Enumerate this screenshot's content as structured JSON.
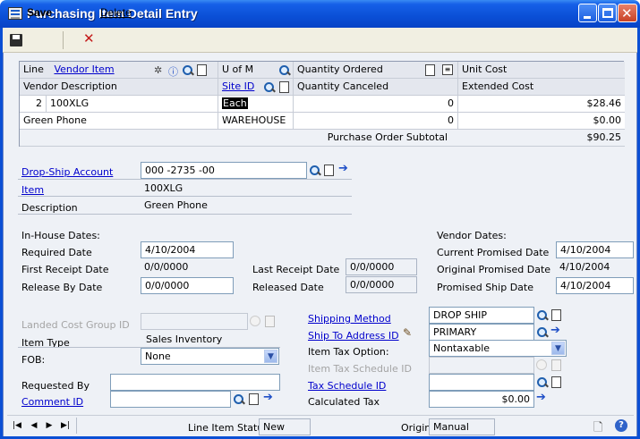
{
  "window": {
    "title": "Purchasing Item Detail Entry"
  },
  "toolbar": {
    "save_label": "Save",
    "delete_label": "Delete"
  },
  "grid": {
    "headers": {
      "line": "Line",
      "vendor_item": "Vendor Item",
      "u_of_m": "U of M",
      "quantity_ordered": "Quantity Ordered",
      "unit_cost": "Unit Cost",
      "vendor_description": "Vendor Description",
      "site_id": "Site ID",
      "quantity_canceled": "Quantity Canceled",
      "extended_cost": "Extended Cost"
    },
    "row": {
      "line": "2",
      "vendor_item": "100XLG",
      "u_of_m": "Each",
      "quantity_ordered": "0",
      "unit_cost": "$28.46",
      "vendor_description": "Green Phone",
      "site_id": "WAREHOUSE",
      "quantity_canceled": "0",
      "extended_cost": "$0.00"
    },
    "subtotal_label": "Purchase Order Subtotal",
    "subtotal_value": "$90.25"
  },
  "details": {
    "drop_ship_account_label": "Drop-Ship Account",
    "drop_ship_account_value": "000 -2735 -00",
    "item_label": "Item",
    "item_value": "100XLG",
    "description_label": "Description",
    "description_value": "Green Phone"
  },
  "in_house": {
    "heading": "In-House Dates:",
    "required_date_label": "Required Date",
    "required_date_value": "4/10/2004",
    "first_receipt_label": "First Receipt Date",
    "first_receipt_value": "0/0/0000",
    "release_by_label": "Release By Date",
    "release_by_value": "0/0/0000",
    "last_receipt_label": "Last Receipt Date",
    "last_receipt_value": "0/0/0000",
    "released_date_label": "Released Date",
    "released_date_value": "0/0/0000"
  },
  "vendor_dates": {
    "heading": "Vendor Dates:",
    "current_promised_label": "Current Promised Date",
    "current_promised_value": "4/10/2004",
    "original_promised_label": "Original Promised Date",
    "original_promised_value": "4/10/2004",
    "promised_ship_label": "Promised Ship Date",
    "promised_ship_value": "4/10/2004"
  },
  "left_lower": {
    "landed_cost_label": "Landed Cost Group ID",
    "landed_cost_value": "",
    "item_type_label": "Item Type",
    "item_type_value": "Sales Inventory",
    "fob_label": "FOB:",
    "fob_value": "None",
    "requested_by_label": "Requested By",
    "requested_by_value": "",
    "comment_id_label": "Comment ID",
    "comment_id_value": ""
  },
  "right_lower": {
    "shipping_method_label": "Shipping Method",
    "shipping_method_value": "DROP SHIP",
    "ship_to_label": "Ship To Address ID",
    "ship_to_value": "PRIMARY",
    "item_tax_option_label": "Item Tax Option:",
    "item_tax_option_value": "Nontaxable",
    "item_tax_schedule_label": "Item Tax Schedule ID",
    "item_tax_schedule_value": "",
    "tax_schedule_label": "Tax Schedule ID",
    "tax_schedule_value": "",
    "calculated_tax_label": "Calculated Tax",
    "calculated_tax_value": "$0.00"
  },
  "footer": {
    "line_status_label": "Line Item Status",
    "line_status_value": "New",
    "origin_label": "Origin",
    "origin_value": "Manual"
  }
}
